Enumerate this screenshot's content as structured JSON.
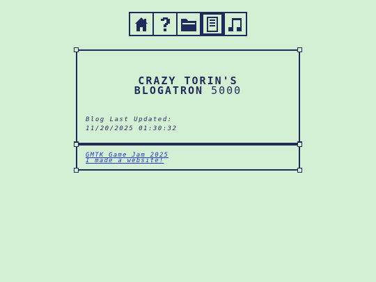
{
  "toolbar": {
    "buttons": [
      {
        "icon": "home-icon",
        "active": false
      },
      {
        "icon": "help-icon",
        "active": false
      },
      {
        "icon": "folder-icon",
        "active": false
      },
      {
        "icon": "document-icon",
        "active": true
      },
      {
        "icon": "music-note-icon",
        "active": false
      }
    ]
  },
  "colors": {
    "background": "#d4f0d4",
    "ink": "#1f2a5a",
    "link": "#2233cc"
  },
  "header": {
    "title_line1": "CRAZY TORIN'S",
    "title_line2_bold": "BLOGATRON",
    "title_line2_thin": " 5000"
  },
  "status": {
    "label": "Blog Last Updated:",
    "timestamp": "11/20/2025 01:30:32"
  },
  "posts": [
    {
      "title": "GMTK Game Jam 2025"
    },
    {
      "title": "I made a website!"
    }
  ]
}
